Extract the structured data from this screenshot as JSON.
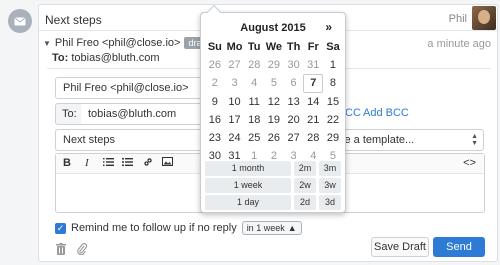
{
  "colors": {
    "accent": "#2e7bd6",
    "badge": "#9aa2aa",
    "muted": "#999999"
  },
  "thread": {
    "subject": "Next steps",
    "user": "Phil",
    "from": "Phil Freo <phil@close.io>",
    "badge": "draft",
    "time_ago": "a minute ago",
    "to_prefix": "To:",
    "to_value": "tobias@bluth.com"
  },
  "compose": {
    "from_value": "Phil Freo <phil@close.io>",
    "to_label": "To:",
    "to_value": "tobias@bluth.com",
    "cc_label": "CC",
    "bcc_label": "Add BCC",
    "subject_value": "Next steps",
    "template_text": "se a template...",
    "toolbar": {
      "bold": "B",
      "italic": "I",
      "code": "<>"
    },
    "reminder_text": "Remind me to follow up if no reply",
    "reminder_checked": true,
    "interval": "in 1 week",
    "save_draft": "Save Draft",
    "send": "Send"
  },
  "datepicker": {
    "title": "August 2015",
    "next": "»",
    "weekdays": [
      "Su",
      "Mo",
      "Tu",
      "We",
      "Th",
      "Fr",
      "Sa"
    ],
    "weeks": [
      [
        "26",
        "27",
        "28",
        "29",
        "30",
        "31",
        "1"
      ],
      [
        "2",
        "3",
        "4",
        "5",
        "6",
        "7",
        "8"
      ],
      [
        "9",
        "10",
        "11",
        "12",
        "13",
        "14",
        "15"
      ],
      [
        "16",
        "17",
        "18",
        "19",
        "20",
        "21",
        "22"
      ],
      [
        "23",
        "24",
        "25",
        "26",
        "27",
        "28",
        "29"
      ],
      [
        "30",
        "31",
        "1",
        "2",
        "3",
        "4",
        "5"
      ]
    ],
    "muted_cells": [
      [
        0,
        0
      ],
      [
        0,
        1
      ],
      [
        0,
        2
      ],
      [
        0,
        3
      ],
      [
        0,
        4
      ],
      [
        0,
        5
      ],
      [
        1,
        0
      ],
      [
        1,
        1
      ],
      [
        1,
        2
      ],
      [
        1,
        3
      ],
      [
        1,
        4
      ],
      [
        5,
        2
      ],
      [
        5,
        3
      ],
      [
        5,
        4
      ],
      [
        5,
        5
      ],
      [
        5,
        6
      ]
    ],
    "today_cell": [
      1,
      5
    ],
    "quick": [
      [
        "1 month",
        "2m",
        "3m"
      ],
      [
        "1 week",
        "2w",
        "3w"
      ],
      [
        "1 day",
        "2d",
        "3d"
      ]
    ]
  },
  "icons": {
    "rail": "envelope-icon",
    "trash": "trash-icon",
    "attach": "paperclip-icon"
  }
}
